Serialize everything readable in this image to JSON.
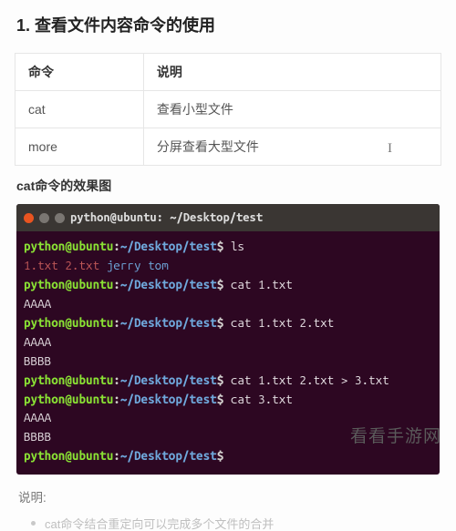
{
  "section": {
    "title": "1. 查看文件内容命令的使用"
  },
  "cmd_table": {
    "headers": {
      "col1": "命令",
      "col2": "说明"
    },
    "rows": [
      {
        "cmd": "cat",
        "desc": "查看小型文件"
      },
      {
        "cmd": "more",
        "desc": "分屏查看大型文件"
      }
    ]
  },
  "subhead": "cat命令的效果图",
  "terminal": {
    "title": "python@ubuntu: ~/Desktop/test",
    "prompt": {
      "user": "python@ubuntu",
      "sep": ":",
      "path": "~/Desktop/test",
      "dollar": "$"
    },
    "lines": [
      {
        "kind": "cmd",
        "text": "ls"
      },
      {
        "kind": "ls",
        "files": [
          "1.txt",
          "2.txt"
        ],
        "dirs": [
          "jerry",
          "tom"
        ]
      },
      {
        "kind": "cmd",
        "text": "cat 1.txt"
      },
      {
        "kind": "out",
        "text": "AAAA"
      },
      {
        "kind": "cmd",
        "text": "cat 1.txt 2.txt"
      },
      {
        "kind": "out",
        "text": "AAAA"
      },
      {
        "kind": "out",
        "text": "BBBB"
      },
      {
        "kind": "cmd",
        "text": "cat 1.txt 2.txt > 3.txt"
      },
      {
        "kind": "cmd",
        "text": "cat 3.txt"
      },
      {
        "kind": "out",
        "text": "AAAA"
      },
      {
        "kind": "out",
        "text": "BBBB"
      },
      {
        "kind": "cmd",
        "text": ""
      }
    ]
  },
  "note_label": "说明:",
  "bullet_text": "cat命令结合重定向可以完成多个文件的合并",
  "watermark": "看看手游网",
  "cursor_char": "I"
}
